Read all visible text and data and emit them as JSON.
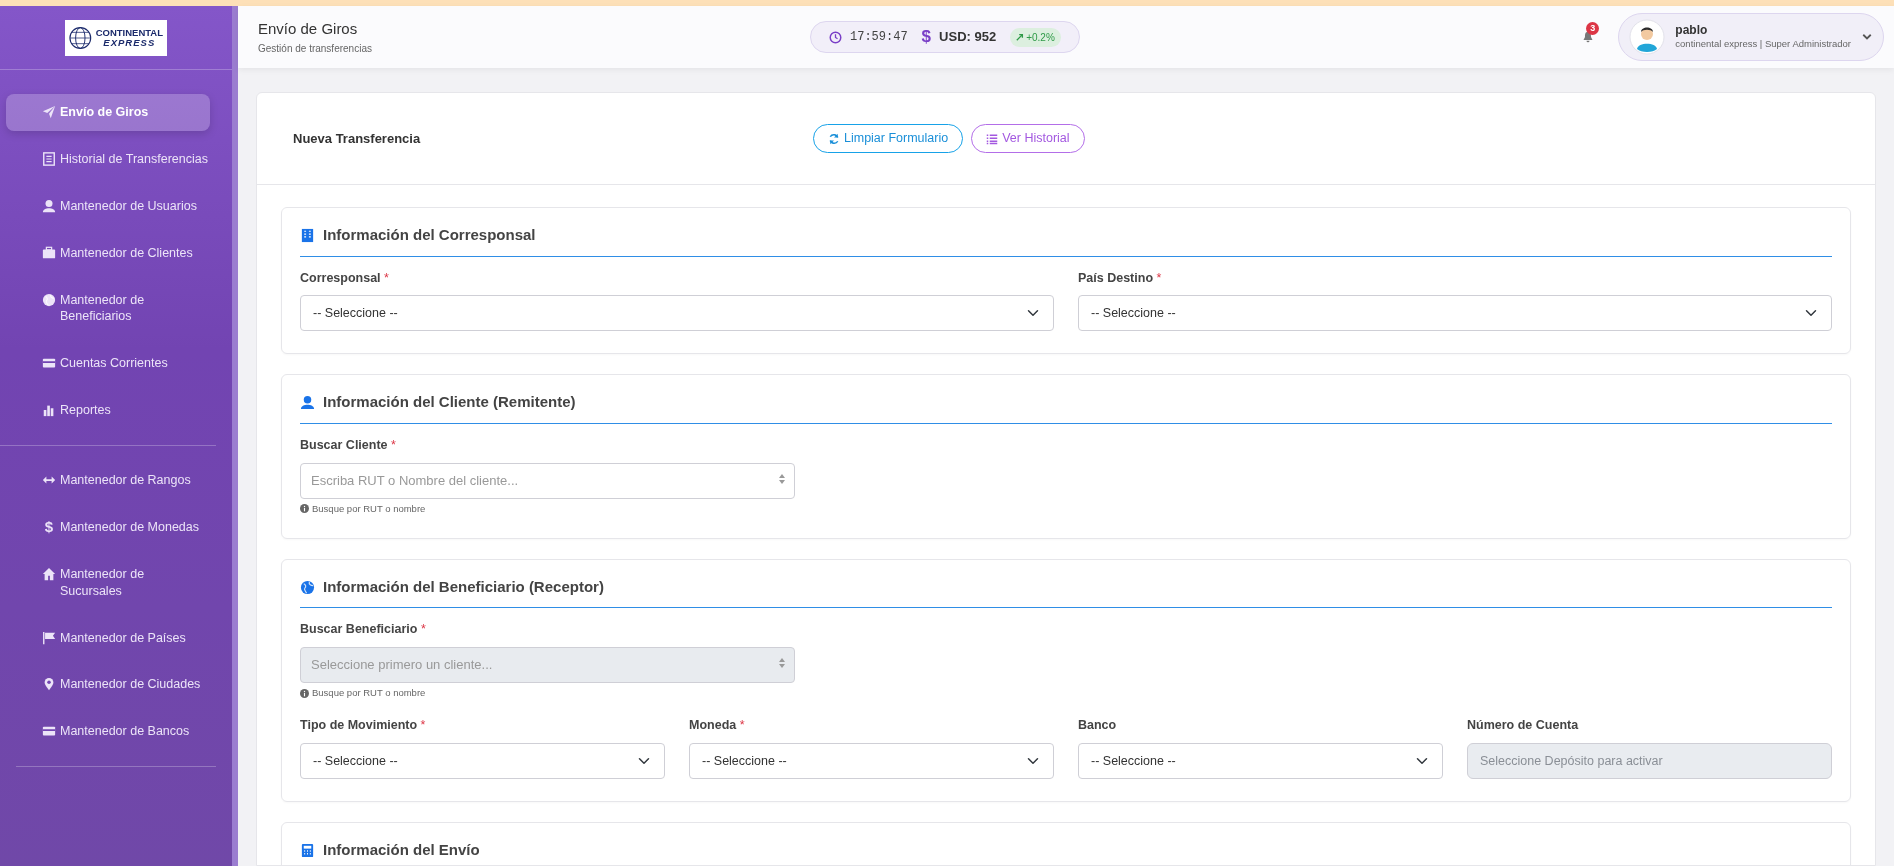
{
  "logo": {
    "line_1": "CONTINENTAL",
    "line_2": "EXPRESS"
  },
  "sidebar": {
    "groups": [
      {
        "items": [
          {
            "label": "Envío de Giros",
            "selected": true
          },
          {
            "label": "Historial de Transferencias",
            "selected": false
          },
          {
            "label": "Mantenedor de Usuarios",
            "selected": false
          },
          {
            "label": "Mantenedor de Clientes",
            "selected": false
          },
          {
            "label": "Mantenedor de Beneficiarios",
            "selected": false
          },
          {
            "label": "Cuentas Corrientes",
            "selected": false
          },
          {
            "label": "Reportes",
            "selected": false
          }
        ]
      },
      {
        "items": [
          {
            "label": "Mantenedor de Rangos",
            "selected": false
          },
          {
            "label": "Mantenedor de Monedas",
            "glyph": "$",
            "selected": false
          },
          {
            "label": "Mantenedor de Sucursales",
            "selected": false
          },
          {
            "label": "Mantenedor de Países",
            "selected": false
          },
          {
            "label": "Mantenedor de Ciudades",
            "selected": false
          },
          {
            "label": "Mantenedor de Bancos",
            "selected": false
          }
        ]
      }
    ]
  },
  "header": {
    "title": "Envío de Giros",
    "subtitle": "Gestión de transferencias",
    "time": "17:59:47",
    "currency_symbol": "$",
    "rate": "USD: 952",
    "change": "+0.2%",
    "notifications": "3",
    "user": {
      "name": "pablo",
      "role": "continental express | Super Administrador"
    }
  },
  "form": {
    "title": "Nueva Transferencia",
    "buttons": [
      {
        "label": "Limpiar Formulario",
        "kind": "clear"
      },
      {
        "label": "Ver Historial",
        "kind": "history"
      }
    ],
    "required_marker": "*",
    "sections": [
      {
        "title": "Información del Corresponsal",
        "fields": [
          {
            "kind": "select",
            "label": "Corresponsal",
            "required": true,
            "value": "-- Seleccione --"
          },
          {
            "kind": "select",
            "label": "País Destino",
            "required": true,
            "value": "-- Seleccione --"
          }
        ]
      },
      {
        "title": "Información del Cliente (Remitente)",
        "fields": [
          {
            "kind": "search",
            "label": "Buscar Cliente",
            "required": true,
            "placeholder": "Escriba RUT o Nombre del cliente...",
            "disabled": false,
            "help": "Busque por RUT o nombre"
          }
        ]
      },
      {
        "title": "Información del Beneficiario (Receptor)",
        "fields": [
          {
            "kind": "search",
            "label": "Buscar Beneficiario",
            "required": true,
            "placeholder": "Seleccione primero un cliente...",
            "disabled": true,
            "help": "Busque por RUT o nombre"
          },
          {
            "kind": "select",
            "label": "Tipo de Movimiento",
            "required": true,
            "value": "-- Seleccione --"
          },
          {
            "kind": "select",
            "label": "Moneda",
            "required": true,
            "value": "-- Seleccione --"
          },
          {
            "kind": "select",
            "label": "Banco",
            "required": false,
            "value": "-- Seleccione --"
          },
          {
            "kind": "input",
            "label": "Número de Cuenta",
            "required": false,
            "placeholder": "Seleccione Depósito para activar",
            "disabled": true
          }
        ]
      },
      {
        "title": "Información del Envío"
      }
    ]
  }
}
